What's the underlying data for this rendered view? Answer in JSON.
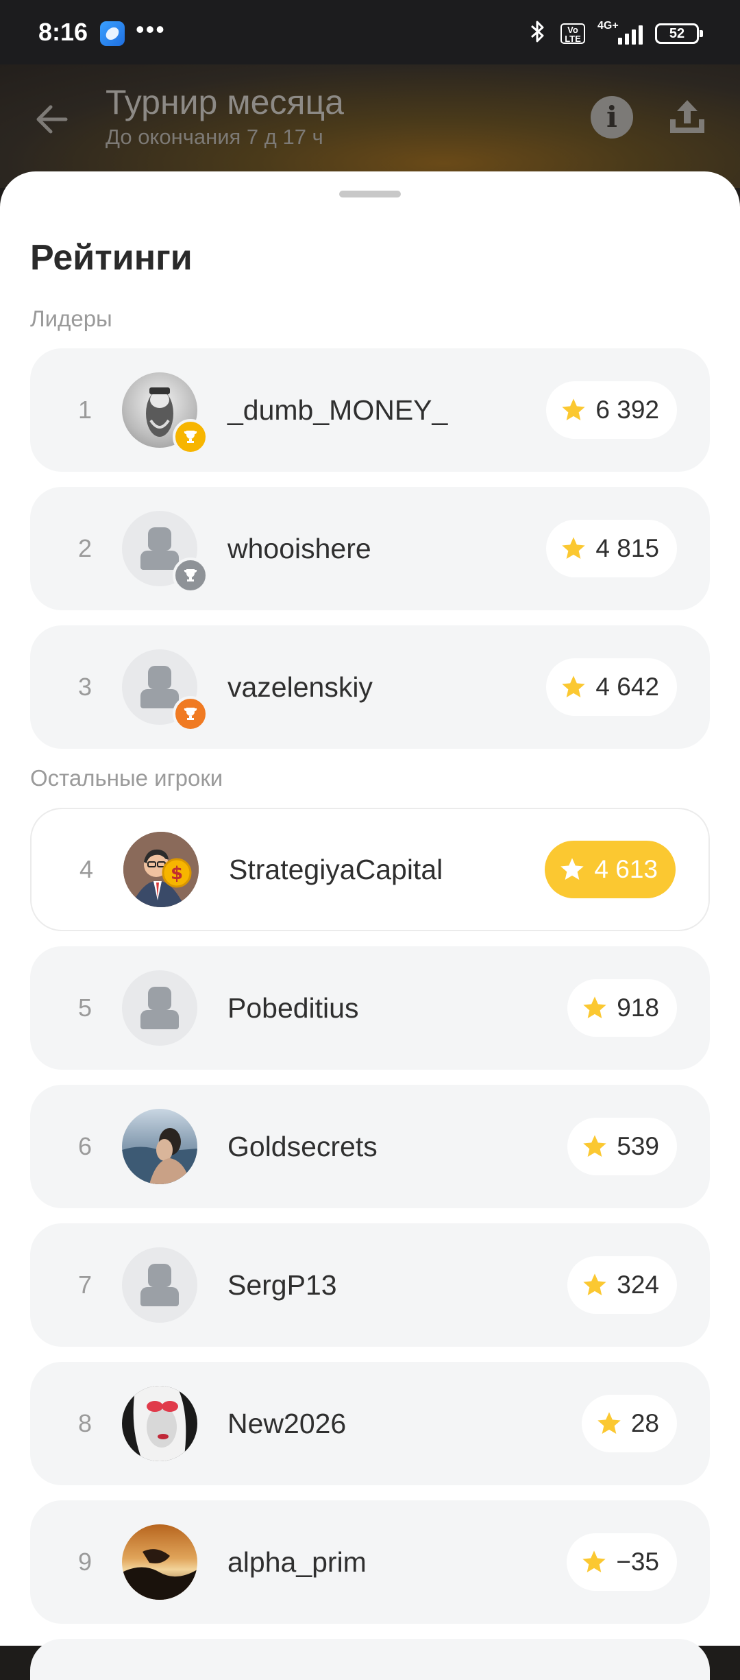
{
  "status_bar": {
    "time": "8:16",
    "dots": "•••",
    "network": "4G+",
    "volte": "Vo LTE",
    "battery": "52"
  },
  "header": {
    "title": "Турнир месяца",
    "subtitle": "До окончания 7 д 17 ч",
    "info_glyph": "i"
  },
  "sheet": {
    "title": "Рейтинги",
    "leaders_label": "Лидеры",
    "others_label": "Остальные игроки"
  },
  "leaders": [
    {
      "rank": "1",
      "name": "_dumb_MONEY_",
      "score": "6 392",
      "trophy": "gold",
      "avatar": "photo-portrait"
    },
    {
      "rank": "2",
      "name": "whooishere",
      "score": "4 815",
      "trophy": "silver",
      "avatar": "placeholder"
    },
    {
      "rank": "3",
      "name": "vazelenskiy",
      "score": "4 642",
      "trophy": "bronze",
      "avatar": "placeholder"
    }
  ],
  "others": [
    {
      "rank": "4",
      "name": "StrategiyaCapital",
      "score": "4 613",
      "current_user": true,
      "avatar": "businessman-coin"
    },
    {
      "rank": "5",
      "name": "Pobeditius",
      "score": "918",
      "avatar": "placeholder"
    },
    {
      "rank": "6",
      "name": "Goldsecrets",
      "score": "539",
      "avatar": "photo-sea"
    },
    {
      "rank": "7",
      "name": "SergP13",
      "score": "324",
      "avatar": "placeholder"
    },
    {
      "rank": "8",
      "name": "New2026",
      "score": "28",
      "avatar": "photo-bw-face"
    },
    {
      "rank": "9",
      "name": "alpha_prim",
      "score": "−35",
      "avatar": "photo-sunset"
    }
  ],
  "colors": {
    "accent_yellow": "#fbc831",
    "gold": "#f7b500",
    "silver": "#8e9297",
    "bronze": "#f07a22",
    "row_bg": "#f4f5f6"
  }
}
